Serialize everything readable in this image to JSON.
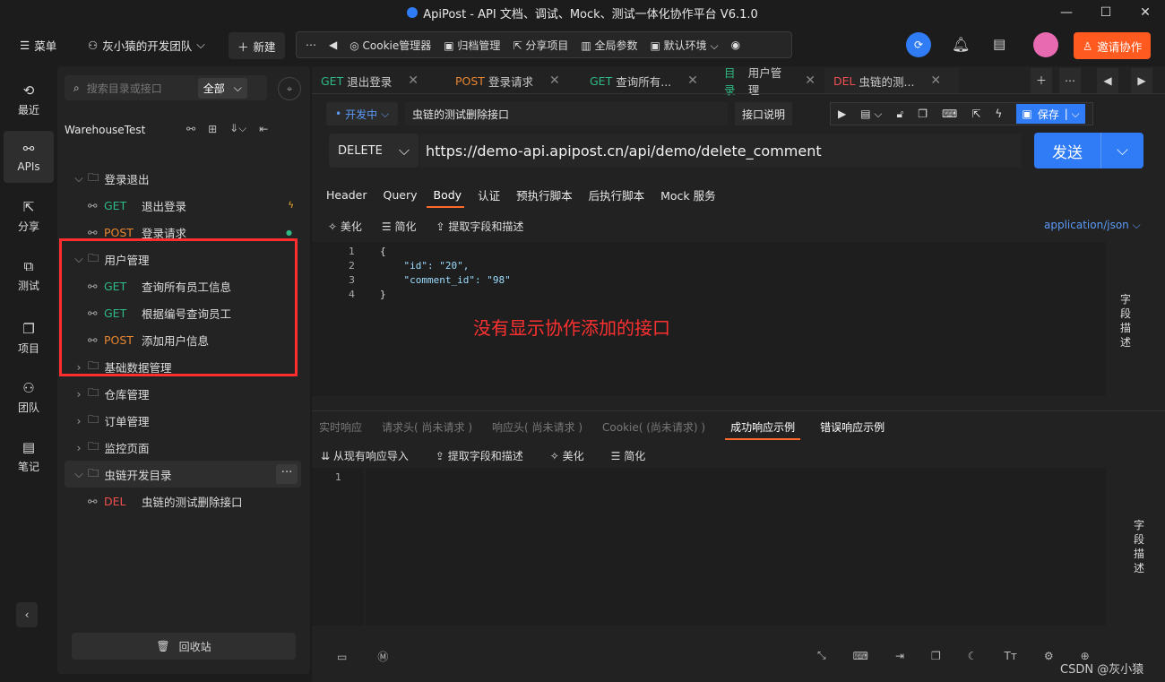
{
  "window": {
    "title": "ApiPost - API 文档、调试、Mock、测试一体化协作平台 V6.1.0",
    "min": "—",
    "max": "☐",
    "close": "✕"
  },
  "topbar": {
    "menu": "菜单",
    "team": "灰小猿的开发团队",
    "new": "新建",
    "cookie": "Cookie管理器",
    "archive": "归档管理",
    "share": "分享项目",
    "globals": "全局参数",
    "env": "默认环境",
    "invite": "邀请协作"
  },
  "rail": [
    {
      "label": "最近",
      "icon": "history-icon"
    },
    {
      "label": "APIs",
      "icon": "link-icon"
    },
    {
      "label": "分享",
      "icon": "share-icon"
    },
    {
      "label": "测试",
      "icon": "test-icon"
    },
    {
      "label": "项目",
      "icon": "project-icon"
    },
    {
      "label": "团队",
      "icon": "team-icon"
    },
    {
      "label": "笔记",
      "icon": "note-icon"
    }
  ],
  "tree": {
    "search_placeholder": "搜索目录或接口",
    "filter": "全部",
    "project": "WarehouseTest",
    "trash": "回收站",
    "rows": [
      {
        "type": "folder",
        "label": "登录退出",
        "open": true
      },
      {
        "type": "api",
        "method": "GET",
        "label": "退出登录"
      },
      {
        "type": "api",
        "method": "POST",
        "label": "登录请求"
      },
      {
        "type": "folder",
        "label": "用户管理",
        "open": true
      },
      {
        "type": "api",
        "method": "GET",
        "label": "查询所有员工信息"
      },
      {
        "type": "api",
        "method": "GET",
        "label": "根据编号查询员工"
      },
      {
        "type": "api",
        "method": "POST",
        "label": "添加用户信息"
      },
      {
        "type": "folder",
        "label": "基础数据管理",
        "open": false
      },
      {
        "type": "folder",
        "label": "仓库管理",
        "open": false
      },
      {
        "type": "folder",
        "label": "订单管理",
        "open": false
      },
      {
        "type": "folder",
        "label": "监控页面",
        "open": false
      },
      {
        "type": "folder",
        "label": "虫链开发目录",
        "open": true
      },
      {
        "type": "api",
        "method": "DEL",
        "label": "虫链的测试删除接口"
      }
    ]
  },
  "annotation": "没有显示协作添加的接口",
  "tabs": [
    {
      "method": "GET",
      "label": "退出登录"
    },
    {
      "method": "POST",
      "label": "登录请求"
    },
    {
      "method": "GET",
      "label": "查询所有..."
    },
    {
      "method": "目录",
      "label": "用户管理"
    },
    {
      "method": "DEL",
      "label": "虫链的测..."
    }
  ],
  "request": {
    "status": "开发中",
    "name": "虫链的测试删除接口",
    "doc": "接口说明",
    "save": "保存",
    "method": "DELETE",
    "url": "https://demo-api.apipost.cn/api/demo/delete_comment",
    "send": "发送"
  },
  "req_tabs": [
    "Header",
    "Query",
    "Body",
    "认证",
    "预执行脚本",
    "后执行脚本",
    "Mock 服务"
  ],
  "body_tools": [
    "美化",
    "简化",
    "提取字段和描述"
  ],
  "content_type": "application/json",
  "body_lines": [
    "{",
    "    \"id\": \"20\",",
    "    \"comment_id\": \"98\"",
    "}"
  ],
  "field_desc": "字段描述",
  "resp_tabs": [
    "实时响应",
    "请求头( 尚未请求 )",
    "响应头( 尚未请求 )",
    "Cookie( (尚未请求) )",
    "成功响应示例",
    "错误响应示例"
  ],
  "resp_tools": [
    "从现有响应导入",
    "提取字段和描述",
    "美化",
    "简化"
  ],
  "watermark": "CSDN @灰小猿"
}
